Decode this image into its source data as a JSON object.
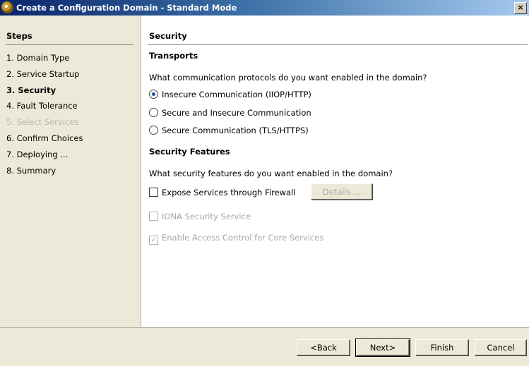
{
  "window": {
    "title": "Create a Configuration Domain - Standard Mode",
    "close_glyph": "×"
  },
  "steps": {
    "heading": "Steps",
    "items": [
      {
        "label": "1. Domain Type"
      },
      {
        "label": "2. Service Startup"
      },
      {
        "label": "3. Security"
      },
      {
        "label": "4. Fault Tolerance"
      },
      {
        "label": "5. Select Services"
      },
      {
        "label": "6. Confirm Choices"
      },
      {
        "label": "7. Deploying ..."
      },
      {
        "label": "8. Summary"
      }
    ],
    "current_index": 2,
    "disabled_index": 4
  },
  "main": {
    "heading": "Security",
    "transports": {
      "heading": "Transports",
      "question": "What communication protocols do you want enabled in the domain?",
      "options": [
        {
          "label": "Insecure Communication (IIOP/HTTP)",
          "selected": true
        },
        {
          "label": "Secure and Insecure Communication",
          "selected": false
        },
        {
          "label": "Secure Communication (TLS/HTTPS)",
          "selected": false
        }
      ]
    },
    "features": {
      "heading": "Security Features",
      "question": "What security features do you want enabled in the domain?",
      "expose": {
        "label": "Expose Services through Firewall",
        "checked": false
      },
      "details_button": "Details ...",
      "iona": {
        "label": "IONA Security Service",
        "checked": false,
        "enabled": false
      },
      "access": {
        "label": "Enable Access Control for Core Services",
        "checked": true,
        "enabled": false
      }
    }
  },
  "buttons": {
    "back": "<Back",
    "next": "Next>",
    "finish": "Finish",
    "cancel": "Cancel"
  }
}
